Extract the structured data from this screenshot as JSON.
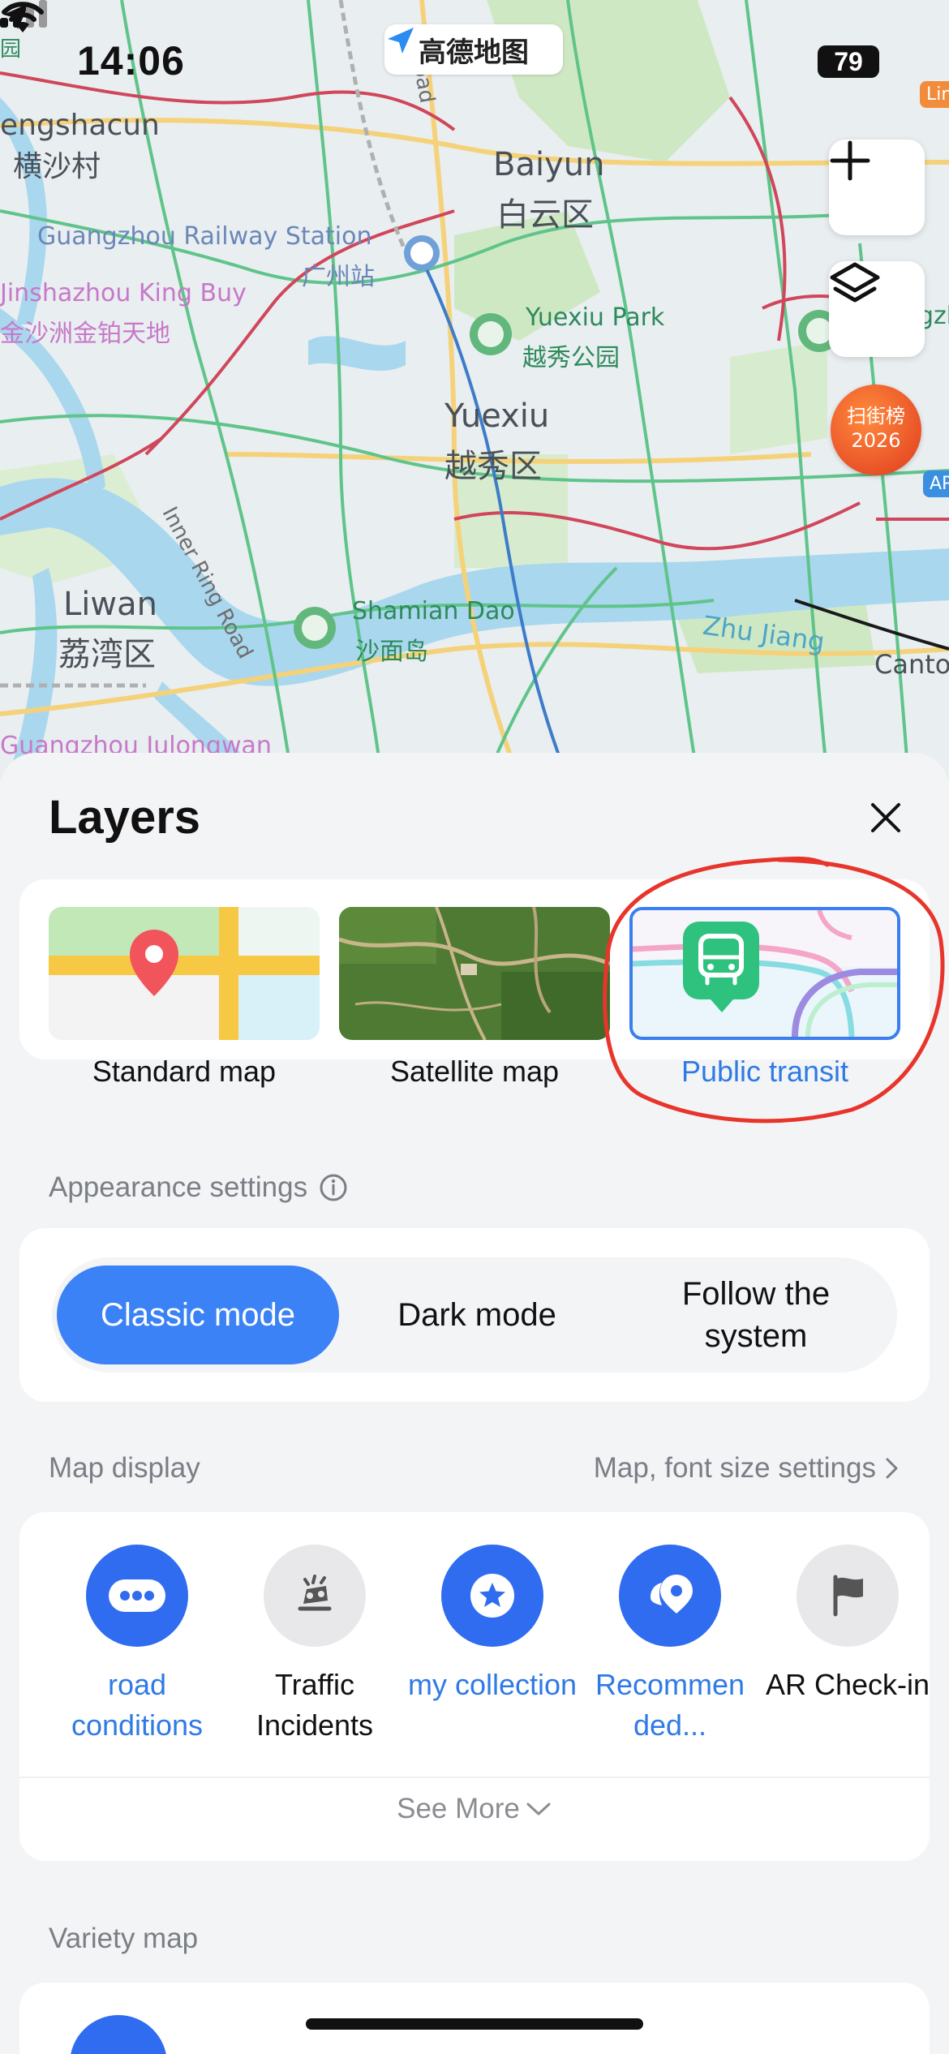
{
  "status_bar": {
    "time": "14:06",
    "battery": "79",
    "app_name": "高德地图"
  },
  "map": {
    "labels": {
      "hengshacun_en": "engshacun",
      "hengshacun_cn": "横沙村",
      "baiyun_en": "Baiyun",
      "baiyun_cn": "白云区",
      "railway_station_en": "Guangzhou Railway Station",
      "railway_station_cn": "广州站",
      "jinshazhou_en": "Jinshazhou King Buy",
      "jinshazhou_cn": "金沙洲金铂天地",
      "yuexiu_park_en": "Yuexiu Park",
      "yuexiu_park_cn": "越秀公园",
      "yuexiu_en": "Yuexiu",
      "yuexiu_cn": "越秀区",
      "inner_ring_road": "Inner Ring Road",
      "liwan_en": "Liwan",
      "liwan_cn": "荔湾区",
      "shamian_en": "Shamian Dao",
      "shamian_cn": "沙面岛",
      "zhujiang": "Zhu Jiang",
      "canton": "Canto",
      "julongwan": "Guangzhou Julongwan",
      "road_label": "Road",
      "line_label": "Line",
      "ap_label": "AP",
      "gz_label": "gzh",
      "yuan_label": "园"
    },
    "promo_badge": {
      "line1": "扫街榜",
      "line2": "2026"
    }
  },
  "sheet": {
    "title": "Layers",
    "map_types": [
      {
        "label": "Standard map"
      },
      {
        "label": "Satellite map"
      },
      {
        "label": "Public transit"
      }
    ],
    "appearance_label": "Appearance settings",
    "modes": [
      {
        "label": "Classic mode"
      },
      {
        "label": "Dark mode"
      },
      {
        "label": "Follow the system"
      }
    ],
    "map_display_label": "Map display",
    "font_settings_link": "Map, font size settings",
    "features": [
      {
        "label": "road conditions",
        "active": true
      },
      {
        "label": "Traffic Incidents",
        "active": false
      },
      {
        "label": "my collection",
        "active": true
      },
      {
        "label": "Recommen ded...",
        "active": true
      },
      {
        "label": "AR Check-in",
        "active": false
      }
    ],
    "see_more": "See More",
    "variety_label": "Variety map"
  },
  "colors": {
    "accent": "#2f6cf0",
    "selected_text": "#2f7ae5",
    "annotation": "#e8352b"
  }
}
